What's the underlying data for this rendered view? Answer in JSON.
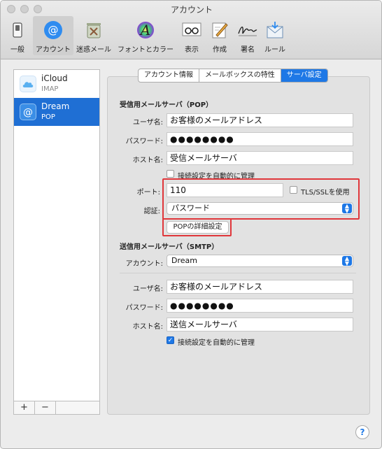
{
  "window": {
    "title": "アカウント"
  },
  "toolbar": {
    "items": [
      {
        "label": "一般",
        "icon": "switch-icon"
      },
      {
        "label": "アカウント",
        "icon": "at-icon",
        "selected": true
      },
      {
        "label": "迷惑メール",
        "icon": "junk-trash-icon"
      },
      {
        "label": "フォントとカラー",
        "icon": "font-color-icon"
      },
      {
        "label": "表示",
        "icon": "glasses-icon"
      },
      {
        "label": "作成",
        "icon": "compose-icon"
      },
      {
        "label": "署名",
        "icon": "signature-icon"
      },
      {
        "label": "ルール",
        "icon": "rules-envelope-icon"
      }
    ]
  },
  "sidebar": {
    "accounts": [
      {
        "name": "iCloud",
        "type": "IMAP",
        "icon": "icloud-icon"
      },
      {
        "name": "Dream",
        "type": "POP",
        "icon": "at-icon",
        "selected": true
      }
    ],
    "add_label": "+",
    "remove_label": "−"
  },
  "tabs": [
    {
      "label": "アカウント情報"
    },
    {
      "label": "メールボックスの特性"
    },
    {
      "label": "サーバ設定",
      "active": true
    }
  ],
  "incoming": {
    "section_title": "受信用メールサーバ（POP）",
    "username_label": "ユーザ名:",
    "username": "お客様のメールアドレス",
    "password_label": "パスワード:",
    "password": "●●●●●●●●",
    "host_label": "ホスト名:",
    "host": "受信メールサーバ",
    "auto_manage_label": "接続設定を自動的に管理",
    "auto_manage_checked": false,
    "port_label": "ポート:",
    "port": "110",
    "tls_label": "TLS/SSLを使用",
    "tls_checked": false,
    "auth_label": "認証:",
    "auth_value": "パスワード",
    "advanced_button": "POPの詳細設定"
  },
  "outgoing": {
    "section_title": "送信用メールサーバ（SMTP）",
    "account_label": "アカウント:",
    "account_value": "Dream",
    "username_label": "ユーザ名:",
    "username": "お客様のメールアドレス",
    "password_label": "パスワード:",
    "password": "●●●●●●●●",
    "host_label": "ホスト名:",
    "host": "送信メールサーバ",
    "auto_manage_label": "接続設定を自動的に管理",
    "auto_manage_checked": true
  },
  "help_label": "?",
  "colors": {
    "accent": "#1e78e6",
    "highlight": "#e0373b",
    "selection": "#1f6fd4"
  }
}
